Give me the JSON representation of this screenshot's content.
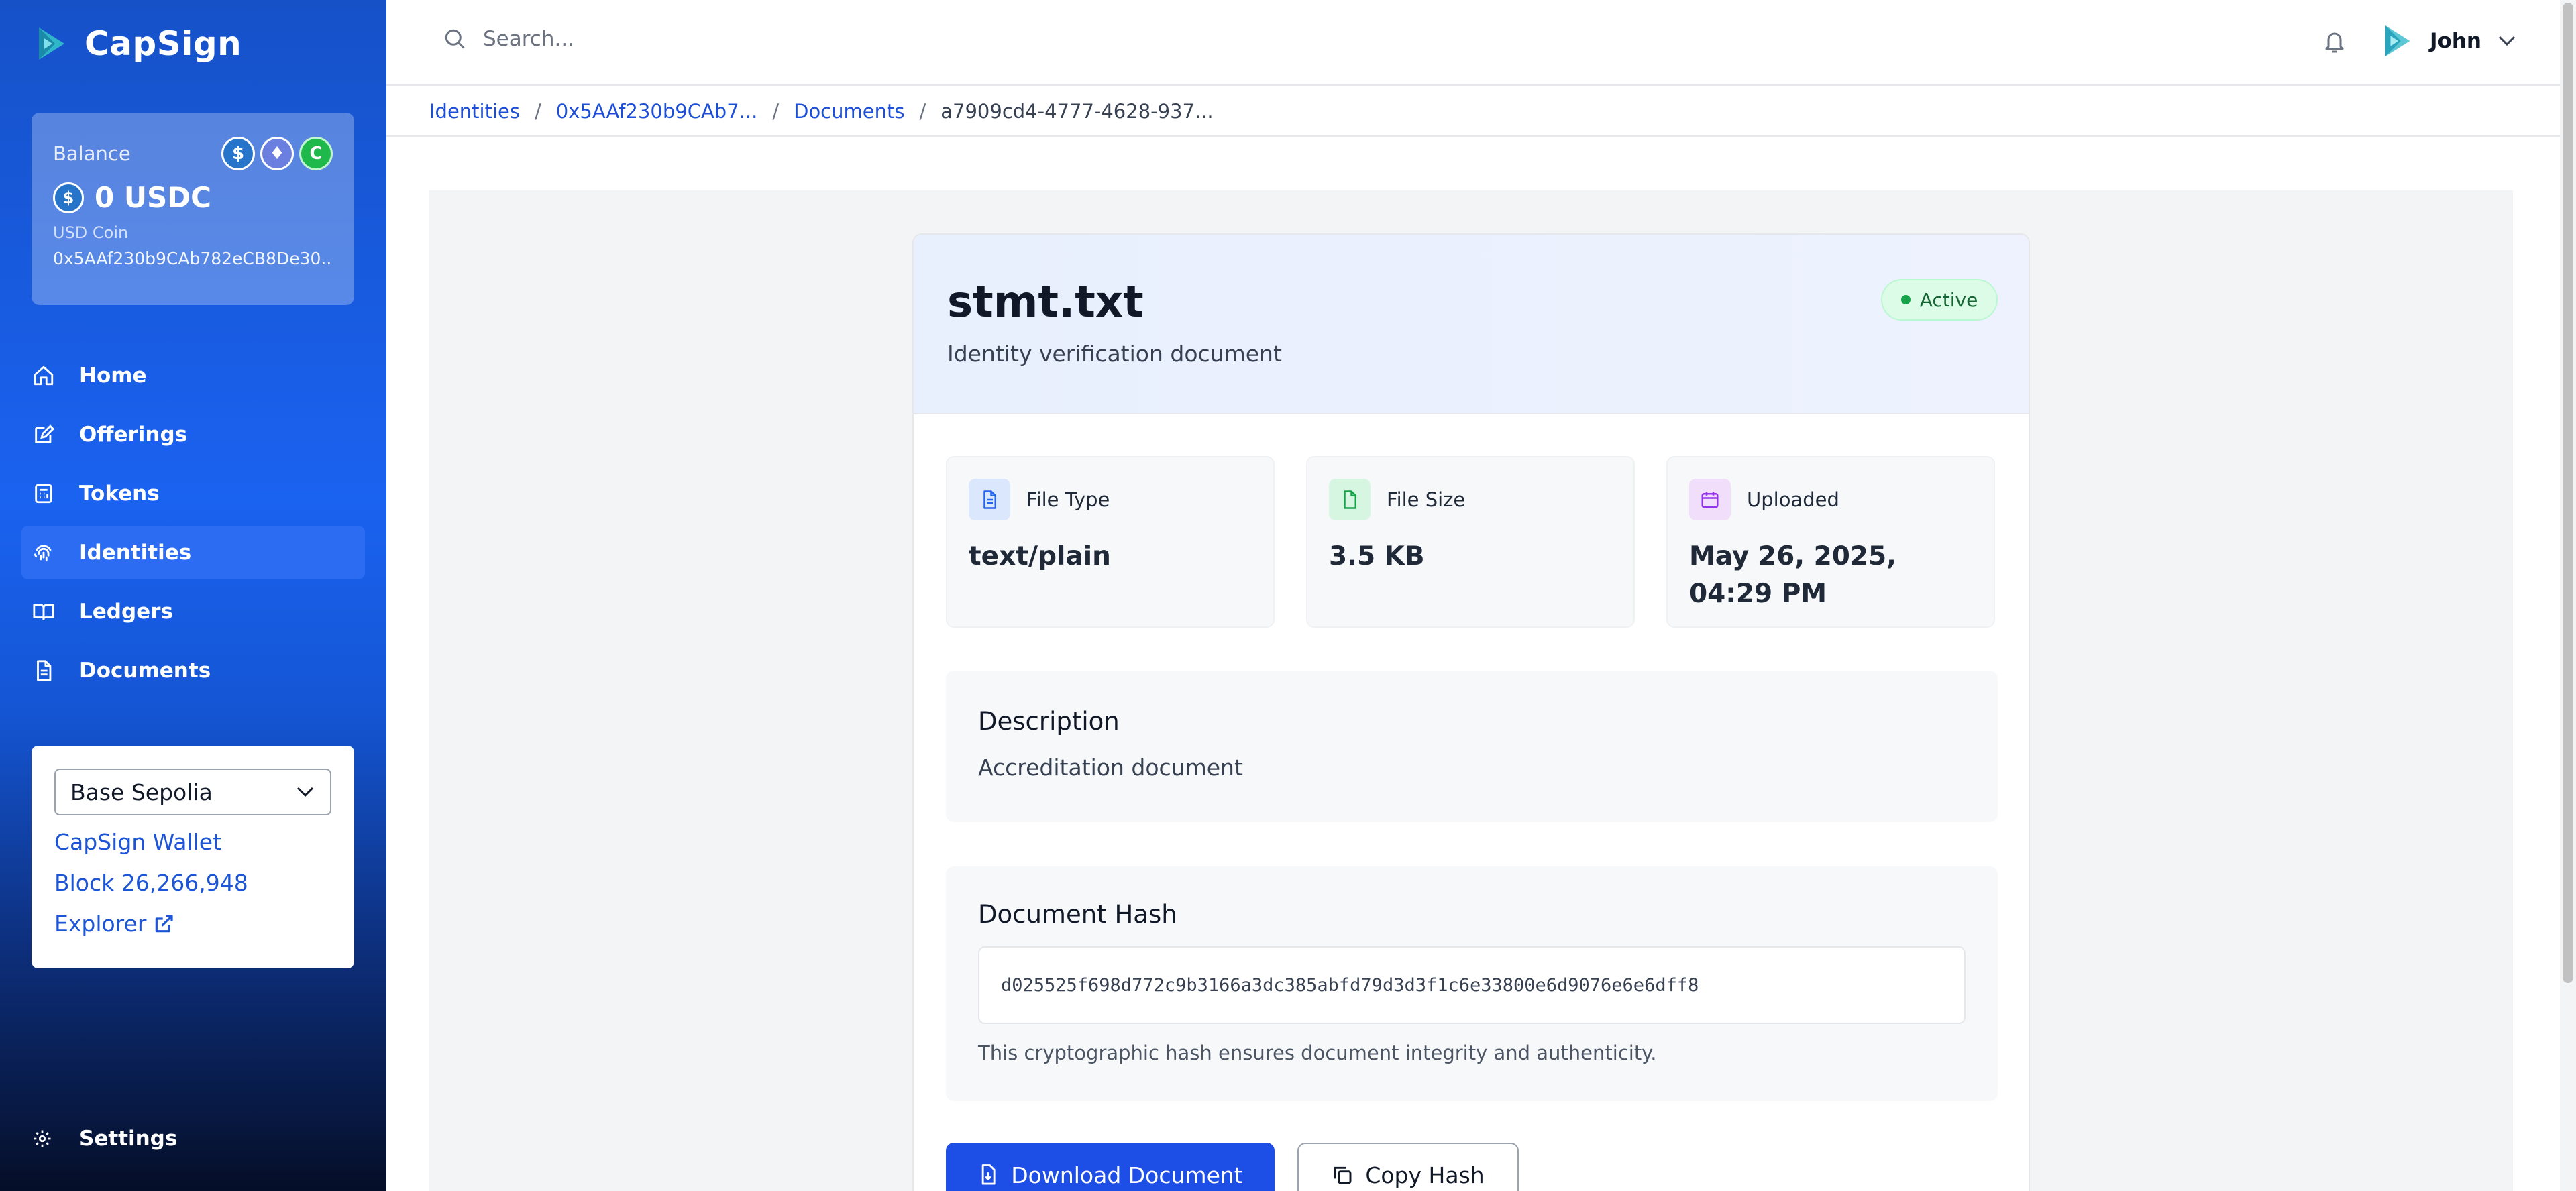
{
  "app": {
    "name": "CapSign"
  },
  "balance": {
    "label": "Balance",
    "amount": "0 USDC",
    "coin_name": "USD Coin",
    "address": "0x5AAf230b9CAb782eCB8De30..."
  },
  "nav": {
    "items": [
      {
        "label": "Home",
        "icon": "home-icon"
      },
      {
        "label": "Offerings",
        "icon": "edit-icon"
      },
      {
        "label": "Tokens",
        "icon": "calculator-icon"
      },
      {
        "label": "Identities",
        "icon": "fingerprint-icon",
        "active": true
      },
      {
        "label": "Ledgers",
        "icon": "book-icon"
      },
      {
        "label": "Documents",
        "icon": "document-icon"
      }
    ],
    "settings_label": "Settings"
  },
  "network": {
    "selected": "Base Sepolia",
    "wallet_link": "CapSign Wallet",
    "block": "Block 26,266,948",
    "explorer_link": "Explorer"
  },
  "search": {
    "placeholder": "Search..."
  },
  "user": {
    "name": "John"
  },
  "breadcrumb": [
    {
      "label": "Identities"
    },
    {
      "label": "0x5AAf230b9CAb7..."
    },
    {
      "label": "Documents"
    },
    {
      "label": "a7909cd4-4777-4628-937..."
    }
  ],
  "document": {
    "title": "stmt.txt",
    "subtitle": "Identity verification document",
    "status": "Active",
    "stats": [
      {
        "label": "File Type",
        "value": "text/plain",
        "icon": "file-text-icon",
        "color": "#2563eb"
      },
      {
        "label": "File Size",
        "value": "3.5 KB",
        "icon": "file-icon",
        "color": "#16a34a"
      },
      {
        "label": "Uploaded",
        "value": "May 26, 2025, 04:29 PM",
        "icon": "calendar-icon",
        "color": "#9333ea"
      }
    ],
    "description": {
      "title": "Description",
      "text": "Accreditation document"
    },
    "hash": {
      "title": "Document Hash",
      "value": "d025525f698d772c9b3166a3dc385abfd79d3d3f1c6e33800e6d9076e6e6dff8",
      "note": "This cryptographic hash ensures document integrity and authenticity."
    },
    "download_label": "Download Document",
    "copy_label": "Copy Hash"
  }
}
